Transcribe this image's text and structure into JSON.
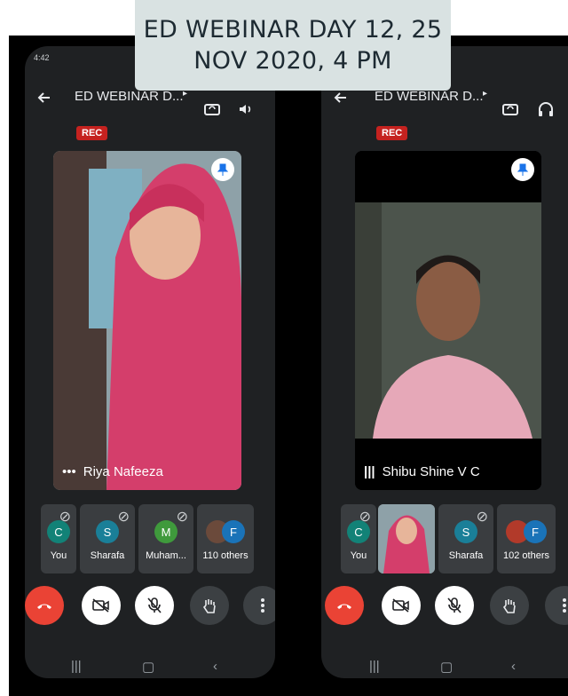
{
  "banner": {
    "line1": "ED WEBINAR DAY 12, 25",
    "line2": "NOV 2020, 4 PM"
  },
  "left_phone": {
    "status_time": "4:42",
    "meeting_title": "ED WEBINAR D...",
    "rec_badge": "REC",
    "main_tile_name": "Riya Nafeeza",
    "participants": [
      {
        "initial": "C",
        "label": "You",
        "color": "#128277"
      },
      {
        "initial": "S",
        "label": "Sharafa",
        "color": "#1a7f98"
      },
      {
        "initial": "M",
        "label": "Muham...",
        "color": "#3f9a3c"
      },
      {
        "initial": "F",
        "label": "110 others",
        "color": "#1a73b8"
      }
    ]
  },
  "right_phone": {
    "meeting_title": "ED WEBINAR D...",
    "rec_badge": "REC",
    "main_tile_name": "Shibu Shine V C",
    "participants": [
      {
        "initial": "C",
        "label": "You",
        "color": "#128277"
      },
      {
        "initial": "S",
        "label": "Sharafa",
        "color": "#1a7f98"
      },
      {
        "initial": "F",
        "label": "102 others",
        "color": "#1a73b8"
      }
    ]
  },
  "colors": {
    "end_call": "#ea4335",
    "rec": "#c5221f",
    "panel": "#1f2123",
    "thumb": "#3a3d40"
  },
  "icons": [
    "back-arrow-icon",
    "switch-camera-icon",
    "speaker-icon",
    "headphones-icon",
    "pin-icon",
    "mic-off-icon",
    "end-call-icon",
    "camera-off-icon",
    "raise-hand-icon",
    "more-vert-icon"
  ]
}
